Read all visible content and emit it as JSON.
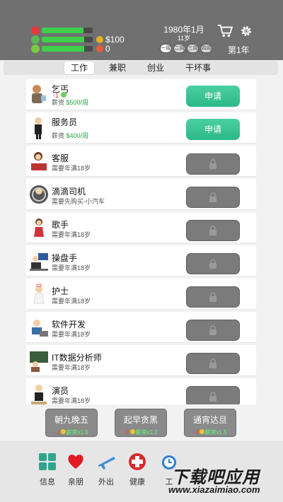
{
  "header": {
    "money": "$100",
    "coin_value": "0",
    "date": "1980年1月",
    "age": "11岁",
    "days": [
      "一周",
      "二周",
      "三周",
      "四周"
    ],
    "year_label": "第1年",
    "stats": {
      "health": 0.82,
      "mood": 0.84,
      "energy": 0.83
    }
  },
  "tabs": [
    {
      "label": "工作",
      "active": true
    },
    {
      "label": "兼职",
      "active": false
    },
    {
      "label": "创业",
      "active": false
    },
    {
      "label": "干坏事",
      "active": false
    }
  ],
  "jobs": [
    {
      "name": "乞丐",
      "requirement": "-1",
      "sub_prefix": "薪资",
      "sub_value": "$500/周",
      "status": "apply",
      "button": "申请",
      "icon": "beggar-avatar"
    },
    {
      "name": "服务员",
      "sub_prefix": "薪资",
      "sub_value": "$400/周",
      "status": "apply",
      "button": "申请",
      "icon": "waiter-avatar"
    },
    {
      "name": "客服",
      "sub_prefix": "需要年满18岁",
      "status": "locked",
      "icon": "customer-service-avatar"
    },
    {
      "name": "滴滴司机",
      "sub_prefix": "需要先购买-小汽车",
      "status": "locked",
      "icon": "driver-avatar"
    },
    {
      "name": "歌手",
      "sub_prefix": "需要年满18岁",
      "status": "locked",
      "icon": "singer-avatar"
    },
    {
      "name": "操盘手",
      "sub_prefix": "需要年满18岁",
      "status": "locked",
      "icon": "trader-avatar"
    },
    {
      "name": "护士",
      "sub_prefix": "需要年满18岁",
      "status": "locked",
      "icon": "nurse-avatar"
    },
    {
      "name": "软件开发",
      "sub_prefix": "需要年满18岁",
      "status": "locked",
      "icon": "developer-avatar"
    },
    {
      "name": "IT数据分析师",
      "sub_prefix": "需要年满18岁",
      "status": "locked",
      "icon": "analyst-avatar"
    },
    {
      "name": "演员",
      "sub_prefix": "需要年满18岁",
      "status": "locked",
      "icon": "actor-avatar"
    }
  ],
  "modes": [
    {
      "title": "朝九晚五",
      "cost": "-1",
      "bonus": "薪资x1.0"
    },
    {
      "title": "起早贪黑",
      "cost": "-2",
      "bonus": "薪资x1.2"
    },
    {
      "title": "通宵达旦",
      "cost": "-3",
      "bonus": "薪资x1.5"
    }
  ],
  "nav": [
    {
      "label": "信息",
      "icon": "info-icon"
    },
    {
      "label": "亲朋",
      "icon": "heart-icon"
    },
    {
      "label": "外出",
      "icon": "plane-icon"
    },
    {
      "label": "健康",
      "icon": "medical-icon"
    },
    {
      "label": "工",
      "icon": "clock-icon"
    }
  ],
  "watermark": {
    "main": "下载吧应用",
    "url": "www.xiazaimiao.com"
  },
  "colors": {
    "accent": "#2bb888",
    "header": "#707070",
    "health_bar": "#3ed04a"
  }
}
